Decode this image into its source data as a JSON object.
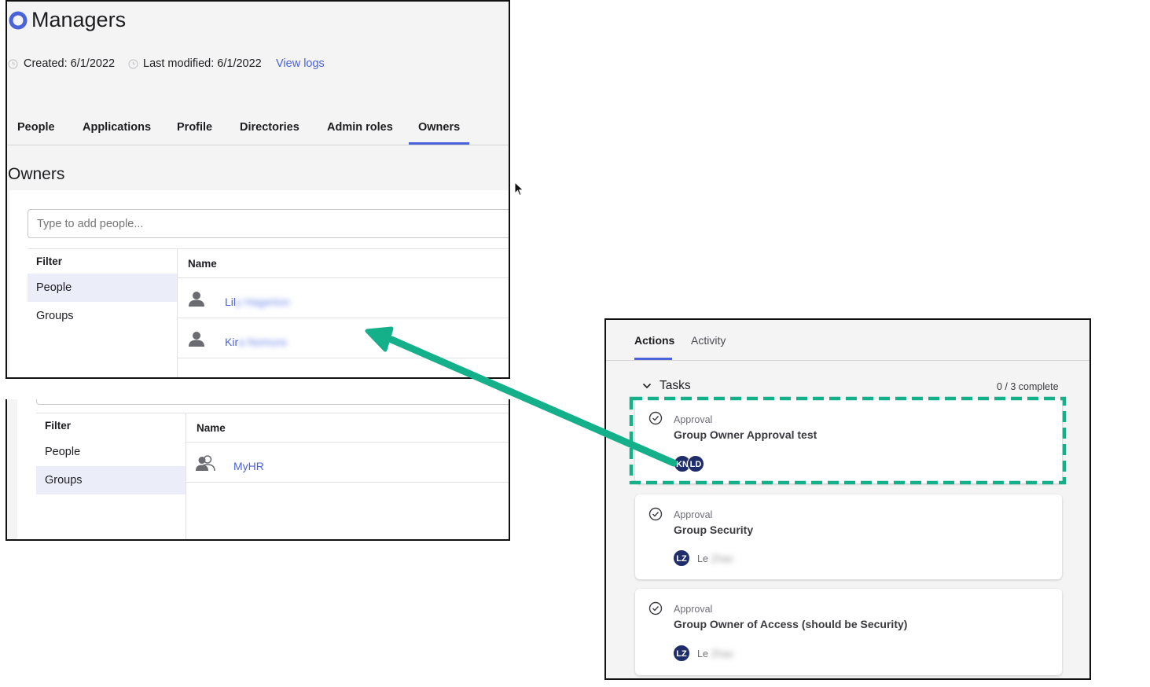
{
  "group_page": {
    "title": "Managers",
    "created_label": "Created: 6/1/2022",
    "modified_label": "Last modified: 6/1/2022",
    "view_logs": "View logs",
    "tabs": [
      "People",
      "Applications",
      "Profile",
      "Directories",
      "Admin roles",
      "Owners"
    ],
    "active_tab": "Owners",
    "section_title": "Owners",
    "search_placeholder": "Type to add people...",
    "filter_header": "Filter",
    "filter_options": [
      "People",
      "Groups"
    ],
    "name_header": "Name",
    "people_rows": [
      {
        "visible": "Lil",
        "redacted": "y Hagerton"
      },
      {
        "visible": "Kir",
        "redacted": "a Nomura"
      }
    ],
    "groups_rows": [
      {
        "name": "MyHR"
      }
    ]
  },
  "tasks_panel": {
    "tabs": [
      "Actions",
      "Activity"
    ],
    "active_tab": "Actions",
    "section_title": "Tasks",
    "progress": "0 / 3 complete",
    "tasks": [
      {
        "type": "Approval",
        "name": "Group Owner Approval test",
        "avatars": [
          "KN",
          "LD"
        ],
        "assignee_visible": "",
        "assignee_redacted": ""
      },
      {
        "type": "Approval",
        "name": "Group Security",
        "avatars": [
          "LZ"
        ],
        "assignee_visible": "Le",
        "assignee_redacted": "Zhao"
      },
      {
        "type": "Approval",
        "name": "Group Owner of Access (should be Security)",
        "avatars": [
          "LZ"
        ],
        "assignee_visible": "Le",
        "assignee_redacted": "Zhao"
      }
    ]
  },
  "colors": {
    "accent": "#4b63d8",
    "annotation": "#14b08a",
    "avatar_bg": "#1f2d6b"
  }
}
